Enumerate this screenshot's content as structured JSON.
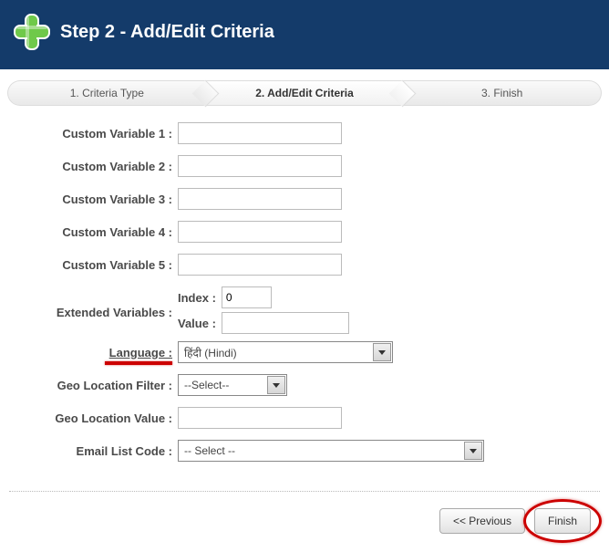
{
  "header": {
    "title": "Step 2 - Add/Edit Criteria"
  },
  "wizard": {
    "steps": [
      {
        "label": "1. Criteria Type"
      },
      {
        "label": "2. Add/Edit Criteria"
      },
      {
        "label": "3. Finish"
      }
    ]
  },
  "form": {
    "custom1": {
      "label": "Custom Variable 1 :",
      "value": ""
    },
    "custom2": {
      "label": "Custom Variable 2 :",
      "value": ""
    },
    "custom3": {
      "label": "Custom Variable 3 :",
      "value": ""
    },
    "custom4": {
      "label": "Custom Variable 4 :",
      "value": ""
    },
    "custom5": {
      "label": "Custom Variable 5 :",
      "value": ""
    },
    "extended": {
      "label": "Extended Variables :",
      "index_label": "Index :",
      "index_value": "0",
      "value_label": "Value :",
      "value_value": ""
    },
    "language": {
      "label": "Language :",
      "selected": "हिंदी (Hindi)"
    },
    "geofilter": {
      "label": "Geo Location Filter :",
      "selected": "--Select--"
    },
    "geovalue": {
      "label": "Geo Location Value :",
      "value": ""
    },
    "emaillist": {
      "label": "Email List Code :",
      "selected": "-- Select --"
    }
  },
  "buttons": {
    "previous": "<< Previous",
    "finish": "Finish"
  }
}
